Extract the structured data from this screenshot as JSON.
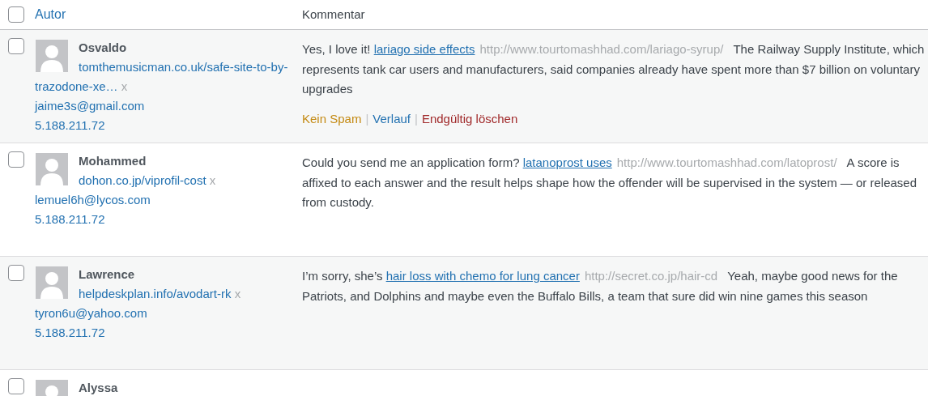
{
  "table": {
    "select_all": {
      "checked": false
    },
    "columns": [
      {
        "label": "Autor",
        "kind": "sortable"
      },
      {
        "label": "Kommentar",
        "kind": "plain"
      }
    ],
    "separator": "|",
    "rows": [
      {
        "checked": false,
        "author": {
          "name": "Osvaldo",
          "url": "tomthemusicman.co.uk/safe-site-to-by-trazodone-xe…",
          "remove": "x",
          "email": "jaime3s@gmail.com",
          "ip": "5.188.211.72"
        },
        "comment": [
          {
            "kind": "text",
            "text": "Yes, I love it! "
          },
          {
            "kind": "link",
            "text": "lariago side effects"
          },
          {
            "kind": "url",
            "text": "http://www.tourtomashhad.com/lariago-syrup/"
          },
          {
            "kind": "text",
            "text": "The Railway Supply Institute, which represents tank car users and manufacturers, said companies already have spent more than $7 billion on voluntary upgrades"
          }
        ],
        "actions": [
          {
            "kind": "unspam",
            "label": "Kein Spam"
          },
          {
            "kind": "history",
            "label": "Verlauf"
          },
          {
            "kind": "delete",
            "label": "Endgültig löschen"
          }
        ]
      },
      {
        "checked": false,
        "author": {
          "name": "Mohammed",
          "url": "dohon.co.jp/viprofil-cost",
          "remove": "x",
          "email": "lemuel6h@lycos.com",
          "ip": "5.188.211.72"
        },
        "comment": [
          {
            "kind": "text",
            "text": "Could you send me an application form? "
          },
          {
            "kind": "link",
            "text": "latanoprost uses"
          },
          {
            "kind": "url",
            "text": "http://www.tourtomashhad.com/latoprost/"
          },
          {
            "kind": "text",
            "text": "A score is affixed to each answer and the result helps shape how the offender will be supervised in the system — or released from custody."
          }
        ]
      },
      {
        "checked": false,
        "author": {
          "name": "Lawrence",
          "url": "helpdeskplan.info/avodart-rk",
          "remove": "x",
          "email": "tyron6u@yahoo.com",
          "ip": "5.188.211.72"
        },
        "comment": [
          {
            "kind": "text",
            "text": "I’m sorry, she’s "
          },
          {
            "kind": "link",
            "text": "hair loss with chemo for lung cancer"
          },
          {
            "kind": "url",
            "text": "http://secret.co.jp/hair-cd"
          },
          {
            "kind": "text",
            "text": "Yeah, maybe good news for the Patriots, and Dolphins and maybe even the Buffalo Bills, a team that sure did win nine games this season"
          }
        ]
      },
      {
        "checked": false,
        "author": {
          "name": "Alyssa"
        }
      }
    ]
  }
}
